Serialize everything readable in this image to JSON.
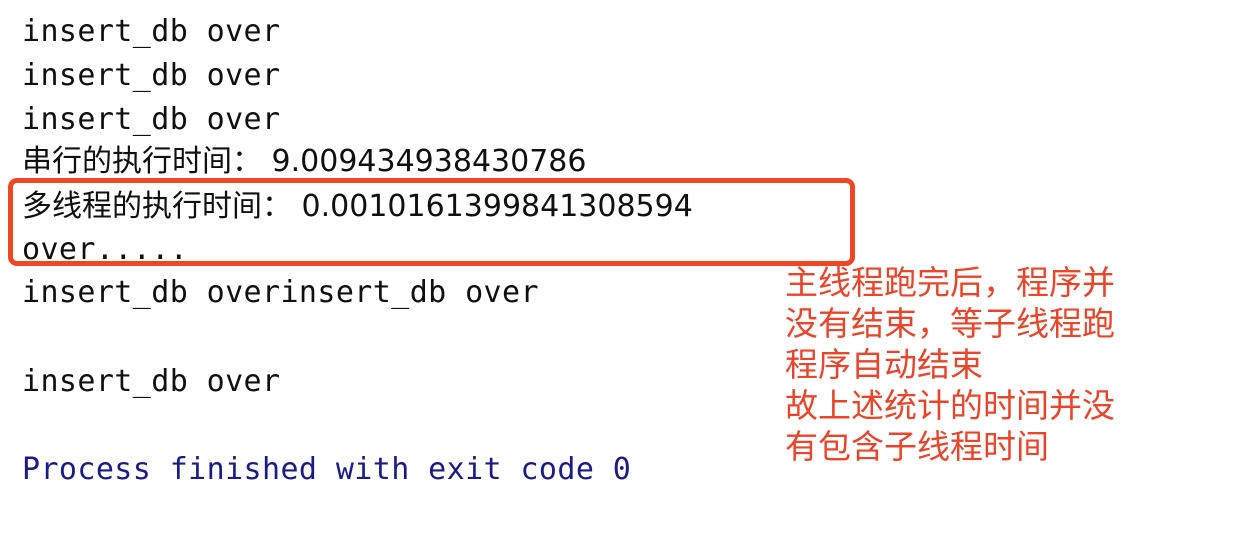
{
  "window": {
    "kind": "ide-run-console",
    "background_color": "#ffffff",
    "text_color": "#101010",
    "system_text_color": "#1b1b86",
    "annotation_color": "#e8452a",
    "highlight_border_color": "#ef4624"
  },
  "console": {
    "partial_top_line": "",
    "lines": [
      {
        "text": "insert_db over",
        "style": "plain"
      },
      {
        "text": "insert_db over",
        "style": "plain"
      },
      {
        "text": "insert_db over",
        "style": "plain"
      },
      {
        "text": "串行的执行时间： 9.009434938430786",
        "style": "cjk"
      },
      {
        "text": "多线程的执行时间： 0.0010161399841308594",
        "style": "cjk"
      },
      {
        "text": "over.....",
        "style": "plain"
      },
      {
        "text": "insert_db overinsert_db over",
        "style": "plain"
      },
      {
        "text": "",
        "style": "blank"
      },
      {
        "text": "insert_db over",
        "style": "plain"
      },
      {
        "text": "",
        "style": "blank"
      },
      {
        "text": "Process finished with exit code 0",
        "style": "navy"
      }
    ],
    "serial_label": "串行的执行时间：",
    "serial_value": "9.009434938430786",
    "multithread_label": "多线程的执行时间：",
    "multithread_value": "0.0010161399841308594",
    "exit_message": "Process finished with exit code 0",
    "exit_code": "0"
  },
  "highlight": {
    "label": "red-rectangle-around-timing-results"
  },
  "annotation": {
    "lines": [
      "主线程跑完后，程序并",
      "没有结束，等子线程跑",
      "程序自动结束",
      "故上述统计的时间并没",
      "有包含子线程时间"
    ],
    "full_text": "主线程跑完后，程序并没有结束，等子线程跑程序自动结束 故上述统计的时间并没有包含子线程时间"
  }
}
